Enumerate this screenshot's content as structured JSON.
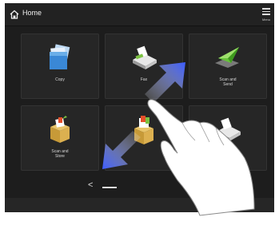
{
  "header": {
    "title": "Home",
    "menu_label": "Menu"
  },
  "tiles": [
    {
      "label": "Copy",
      "icon": "copy-icon"
    },
    {
      "label": "Fax",
      "icon": "fax-icon"
    },
    {
      "label": "Scan and\nSend",
      "icon": "scan-send-icon"
    },
    {
      "label": "Scan and\nStore",
      "icon": "scan-store-icon"
    },
    {
      "label": "",
      "icon": "access-stored-files-icon"
    },
    {
      "label": "",
      "icon": "fax-icon"
    }
  ],
  "pager": {
    "prev_symbol": "<"
  },
  "colors": {
    "screen": "#1d1d1d",
    "tile": "#262626",
    "arrow": "#3b5bff"
  }
}
